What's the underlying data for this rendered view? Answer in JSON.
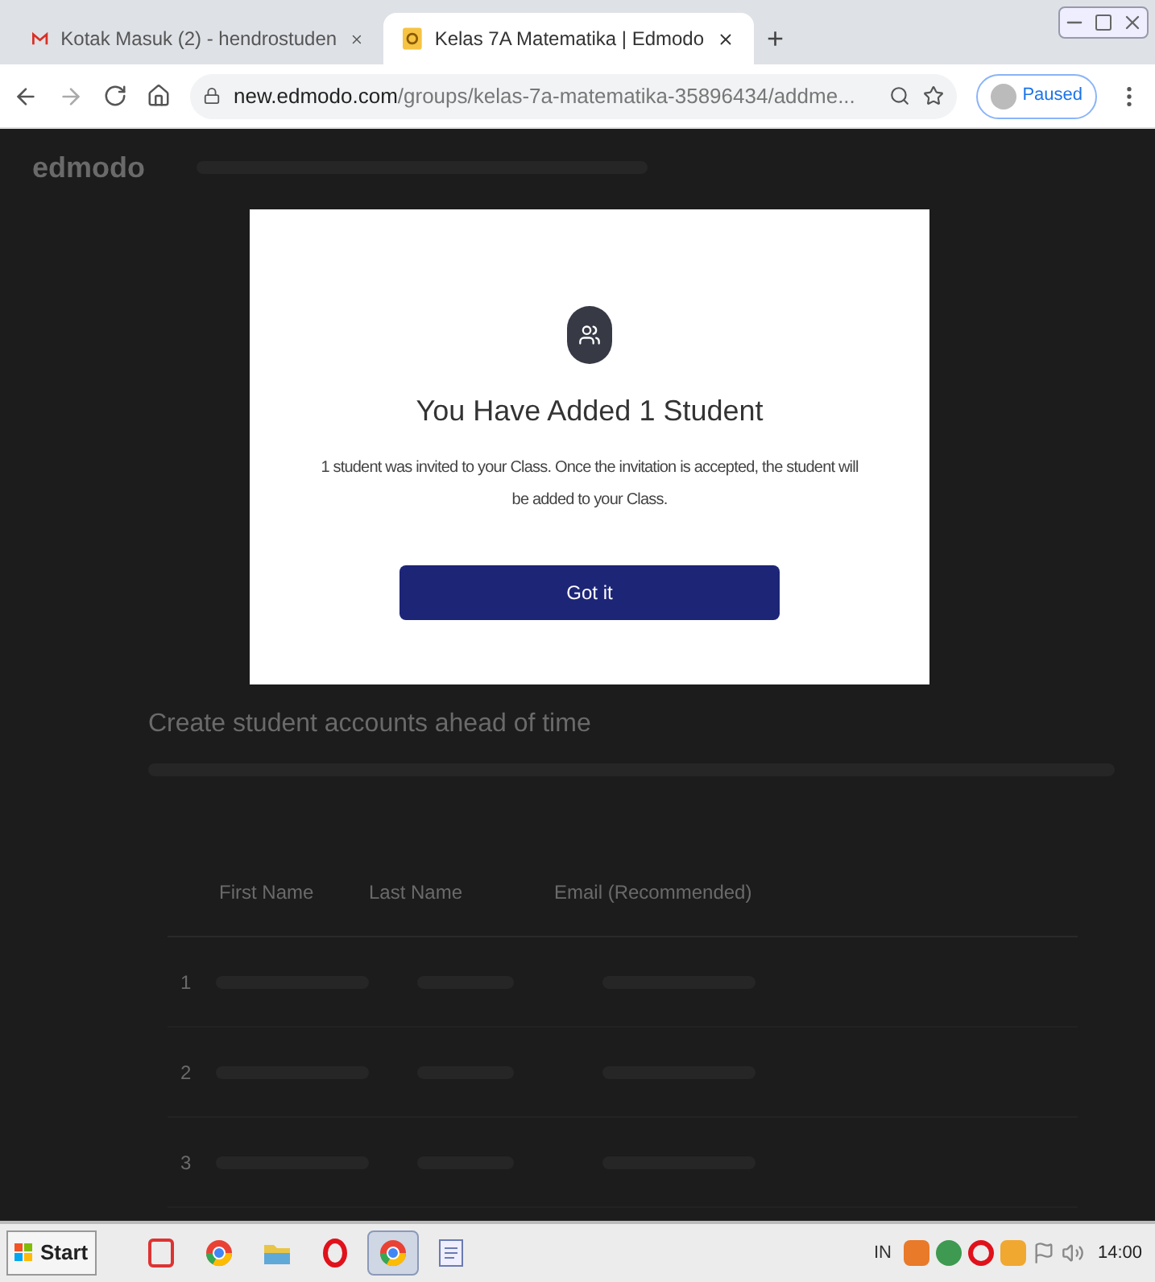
{
  "browser": {
    "tabs": [
      {
        "title": "Kotak Masuk (2) - hendrostuden",
        "kind": "mail",
        "selected": false
      },
      {
        "title": "Kelas 7A Matematika | Edmodo",
        "kind": "edmodo",
        "selected": true
      }
    ],
    "new_tab": "+",
    "url_host": "new.edmodo.com",
    "url_path": "/groups/kelas-7a-matematika-35896434/addme...",
    "profile": "Paused"
  },
  "page": {
    "logo": "edmodo",
    "section_title": "Create student accounts ahead of time",
    "table": {
      "columns": [
        "First Name",
        "Last Name",
        "Email (Recommended)"
      ],
      "rows": [
        "1",
        "2",
        "3"
      ]
    }
  },
  "modal": {
    "title": "You Have Added 1 Student",
    "message": "1 student was invited to your Class. Once the invitation is accepted, the student will be added to your Class.",
    "button": "Got it"
  },
  "taskbar": {
    "start": "Start",
    "apps": [
      {
        "kind": "pdf",
        "active": false
      },
      {
        "kind": "chrome",
        "active": false
      },
      {
        "kind": "folder",
        "active": false
      },
      {
        "kind": "opera",
        "active": false
      },
      {
        "kind": "chrome",
        "active": true
      },
      {
        "kind": "doc",
        "active": false
      }
    ],
    "language": "IN",
    "clock": "14:00"
  }
}
